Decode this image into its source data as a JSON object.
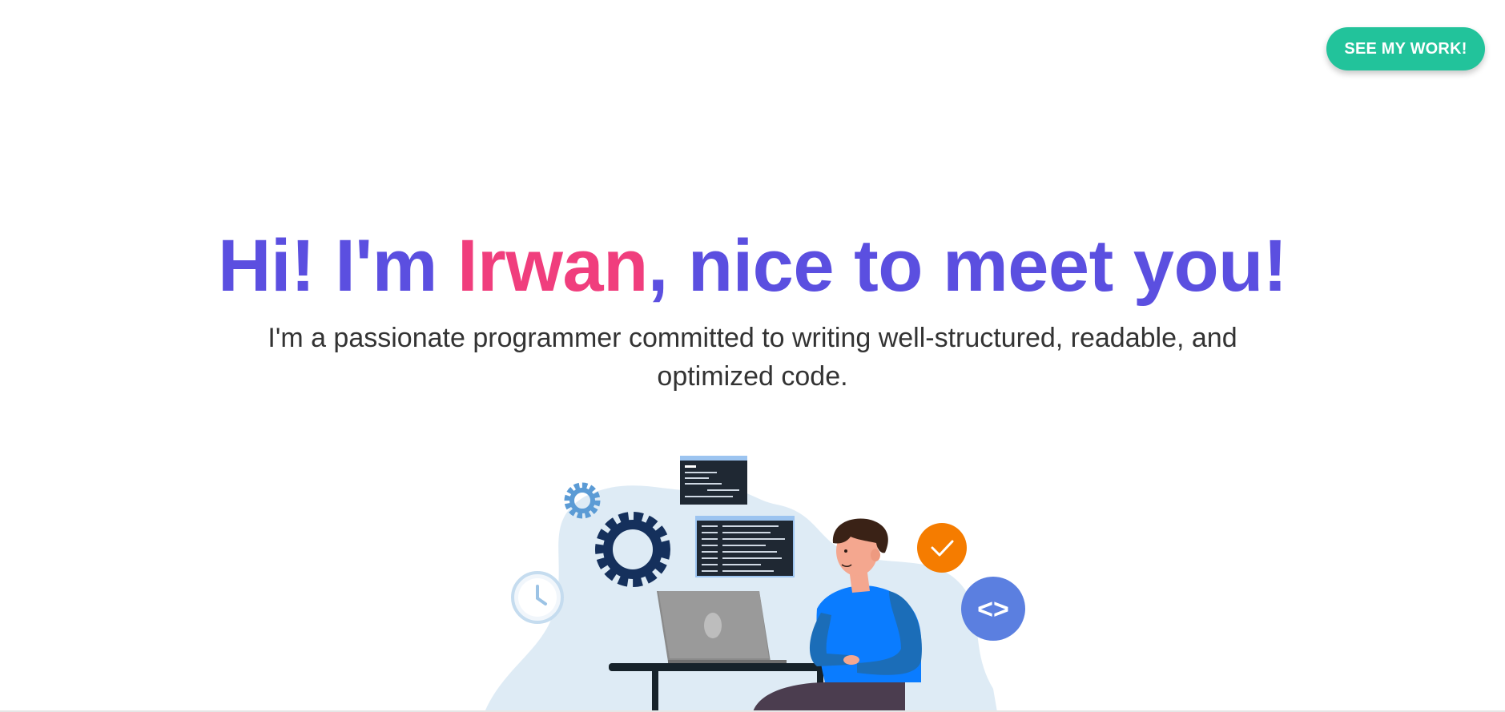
{
  "header": {
    "cta_label": "SEE MY WORK!"
  },
  "hero": {
    "headline_before": "Hi! I'm ",
    "headline_name": "Irwan",
    "headline_after": ", nice to meet you!",
    "subtitle_line1": "I'm a passionate programmer committed to writing well-structured, readable, and",
    "subtitle_line2": "optimized code."
  },
  "illustration": {
    "code_icon_text": "<>",
    "icons": [
      "gear-icon",
      "clock-icon",
      "check-icon",
      "code-icon",
      "code-window",
      "laptop",
      "desk",
      "person"
    ]
  },
  "colors": {
    "headline": "#5b4fe0",
    "name_accent": "#f03e7d",
    "cta": "#22c39b",
    "subtitle": "#333333",
    "blob": "#deebf5",
    "gear_dark": "#15305c",
    "gear_light": "#5b9bd5",
    "check_circle": "#f57c00",
    "code_circle": "#5b7fe0"
  }
}
